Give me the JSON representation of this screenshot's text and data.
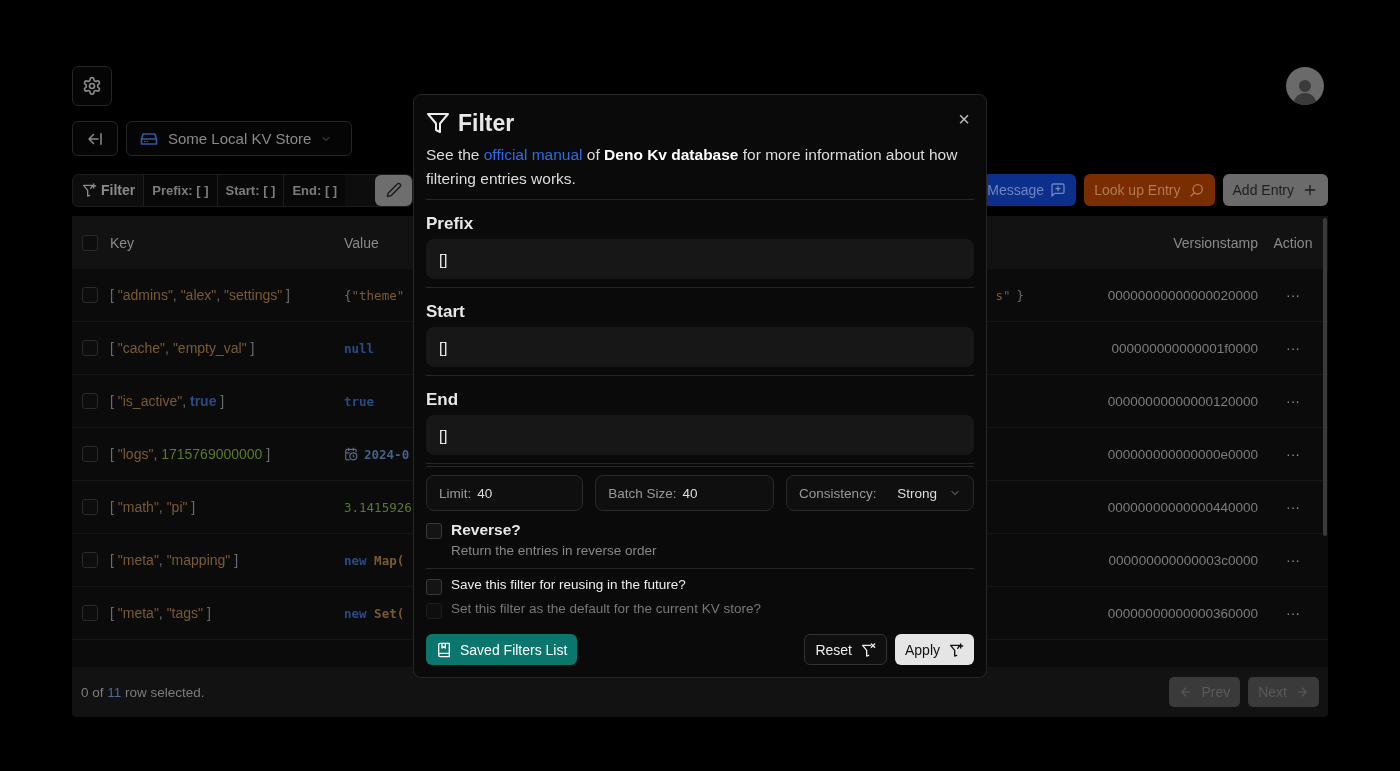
{
  "store": {
    "name": "Some Local KV Store"
  },
  "toolbar": {
    "filter_label": "Filter",
    "chips": [
      "Prefix: [ ]",
      "Start: [ ]",
      "End: [ ]"
    ],
    "buttons": [
      {
        "label": "Message",
        "kind": "message"
      },
      {
        "label": "Look up Entry",
        "kind": "lookup"
      },
      {
        "label": "Add Entry",
        "kind": "add"
      }
    ]
  },
  "table": {
    "columns": [
      "Key",
      "Value",
      "Versionstamp",
      "Action"
    ],
    "header_checked": false,
    "rows": [
      {
        "checked": false,
        "key": [
          {
            "kind": "punct",
            "text": "[ "
          },
          {
            "kind": "string",
            "text": "\"admins\""
          },
          {
            "kind": "punct",
            "text": ", "
          },
          {
            "kind": "string",
            "text": "\"alex\""
          },
          {
            "kind": "punct",
            "text": ", "
          },
          {
            "kind": "string",
            "text": "\"settings\""
          },
          {
            "kind": "punct",
            "text": " ]"
          }
        ],
        "value": [
          {
            "kind": "punct",
            "text": "{"
          },
          {
            "kind": "string",
            "text": "\"theme\""
          }
        ],
        "value_end": [
          {
            "kind": "string",
            "text": "s\""
          },
          {
            "kind": "punct",
            "text": "}"
          }
        ],
        "versionstamp": "00000000000000020000",
        "action": "···"
      },
      {
        "checked": false,
        "key": [
          {
            "kind": "punct",
            "text": "[ "
          },
          {
            "kind": "string",
            "text": "\"cache\""
          },
          {
            "kind": "punct",
            "text": ", "
          },
          {
            "kind": "string",
            "text": "\"empty_val\""
          },
          {
            "kind": "punct",
            "text": " ]"
          }
        ],
        "value": [
          {
            "kind": "keyword",
            "text": "null"
          }
        ],
        "versionstamp": "000000000000001f0000",
        "action": "···"
      },
      {
        "checked": false,
        "key": [
          {
            "kind": "punct",
            "text": "[ "
          },
          {
            "kind": "string",
            "text": "\"is_active\""
          },
          {
            "kind": "punct",
            "text": ", "
          },
          {
            "kind": "keyword",
            "text": "true"
          },
          {
            "kind": "punct",
            "text": " ]"
          }
        ],
        "value": [
          {
            "kind": "keyword",
            "text": "true"
          }
        ],
        "versionstamp": "00000000000000120000",
        "action": "···"
      },
      {
        "checked": false,
        "key": [
          {
            "kind": "punct",
            "text": "[ "
          },
          {
            "kind": "string",
            "text": "\"logs\""
          },
          {
            "kind": "punct",
            "text": ", "
          },
          {
            "kind": "number",
            "text": "1715769000000"
          },
          {
            "kind": "punct",
            "text": " ]"
          }
        ],
        "value": [
          {
            "kind": "date",
            "text": "2024-0"
          }
        ],
        "versionstamp": "000000000000000e0000",
        "action": "···"
      },
      {
        "checked": false,
        "key": [
          {
            "kind": "punct",
            "text": "[ "
          },
          {
            "kind": "string",
            "text": "\"math\""
          },
          {
            "kind": "punct",
            "text": ", "
          },
          {
            "kind": "string",
            "text": "\"pi\""
          },
          {
            "kind": "punct",
            "text": " ]"
          }
        ],
        "value": [
          {
            "kind": "number",
            "text": "3.1415926"
          }
        ],
        "versionstamp": "00000000000000440000",
        "action": "···"
      },
      {
        "checked": false,
        "key": [
          {
            "kind": "punct",
            "text": "[ "
          },
          {
            "kind": "string",
            "text": "\"meta\""
          },
          {
            "kind": "punct",
            "text": ", "
          },
          {
            "kind": "string",
            "text": "\"mapping\""
          },
          {
            "kind": "punct",
            "text": " ]"
          }
        ],
        "value": [
          {
            "kind": "keyword",
            "text": "new "
          },
          {
            "kind": "class",
            "text": "Map("
          }
        ],
        "versionstamp": "000000000000003c0000",
        "action": "···"
      },
      {
        "checked": false,
        "key": [
          {
            "kind": "punct",
            "text": "[ "
          },
          {
            "kind": "string",
            "text": "\"meta\""
          },
          {
            "kind": "punct",
            "text": ", "
          },
          {
            "kind": "string",
            "text": "\"tags\""
          },
          {
            "kind": "punct",
            "text": " ]"
          }
        ],
        "value": [
          {
            "kind": "keyword",
            "text": "new "
          },
          {
            "kind": "class",
            "text": "Set("
          }
        ],
        "versionstamp": "00000000000000360000",
        "action": "···"
      }
    ],
    "footer": {
      "before": "0 of ",
      "count": "11",
      "after": " row selected."
    },
    "pager": [
      {
        "label": "Prev",
        "kind": "prev",
        "disabled": true
      },
      {
        "label": "Next",
        "kind": "next",
        "disabled": true
      }
    ]
  },
  "dialog": {
    "title": "Filter",
    "close": "×",
    "description": {
      "before": "See the ",
      "link": "official manual",
      "after": " of **Deno Kv database** for more information about how filtering entries works."
    },
    "fields": [
      {
        "label": "Prefix",
        "value": "[]"
      },
      {
        "label": "Start",
        "value": "[]"
      },
      {
        "label": "End",
        "value": "[]"
      }
    ],
    "options": [
      {
        "label": "Limit:",
        "value": "40",
        "kind": "input"
      },
      {
        "label": "Batch Size:",
        "value": "40",
        "kind": "input"
      },
      {
        "label": "Consistency:",
        "value": "Strong",
        "kind": "select"
      }
    ],
    "reverse": {
      "label": "Reverse?",
      "hint": "Return the entries in reverse order",
      "checked": false
    },
    "save_options": [
      {
        "label": "Save this filter for reusing in the future?",
        "checked": false,
        "disabled": false
      },
      {
        "label": "Set this filter as the default for the current KV store?",
        "checked": false,
        "disabled": true
      }
    ],
    "buttons": [
      {
        "label": "Saved Filters List",
        "kind": "saved"
      },
      {
        "label": "Reset",
        "kind": "reset"
      },
      {
        "label": "Apply",
        "kind": "apply"
      }
    ]
  }
}
